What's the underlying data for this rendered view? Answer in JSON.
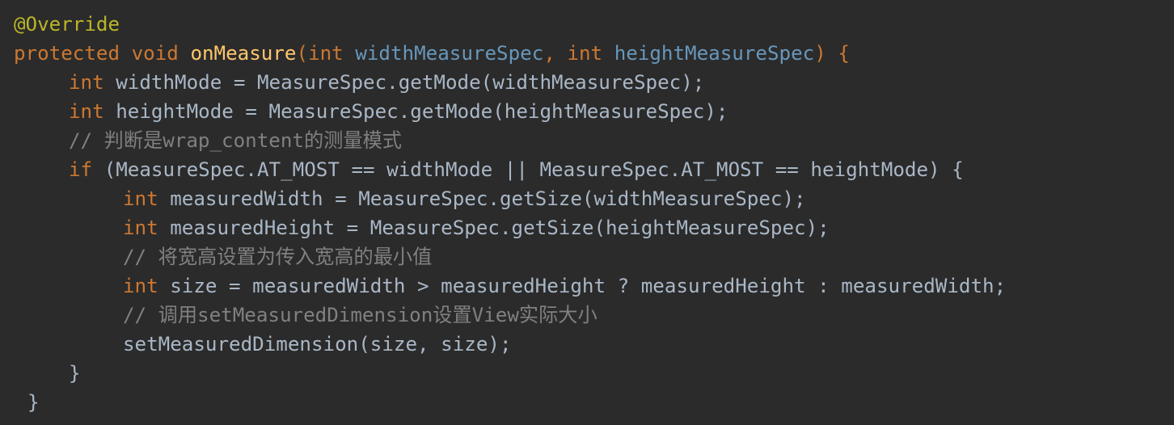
{
  "code": {
    "l1": {
      "annotation": "@Override"
    },
    "l2": {
      "kw_protected": "protected",
      "kw_void": "void",
      "method": "onMeasure",
      "paren_open": "(",
      "type1": "int",
      "param1": "widthMeasureSpec",
      "comma": ", ",
      "type2": "int",
      "param2": "heightMeasureSpec",
      "paren_close": ") {"
    },
    "l3": {
      "type": "int",
      "rest": "widthMode = MeasureSpec.getMode(widthMeasureSpec);"
    },
    "l4": {
      "type": "int",
      "rest": "heightMode = MeasureSpec.getMode(heightMeasureSpec);"
    },
    "l5": {
      "comment": "// 判断是wrap_content的测量模式"
    },
    "l6": {
      "kw": "if",
      "rest": "(MeasureSpec.AT_MOST == widthMode || MeasureSpec.AT_MOST == heightMode) {"
    },
    "l7": {
      "type": "int",
      "rest": "measuredWidth = MeasureSpec.getSize(widthMeasureSpec);"
    },
    "l8": {
      "type": "int",
      "rest": "measuredHeight = MeasureSpec.getSize(heightMeasureSpec);"
    },
    "l9": {
      "comment": "// 将宽高设置为传入宽高的最小值"
    },
    "l10": {
      "type": "int",
      "rest": "size = measuredWidth > measuredHeight ? measuredHeight : measuredWidth;"
    },
    "l11": {
      "comment": "// 调用setMeasuredDimension设置View实际大小"
    },
    "l12": {
      "text": "setMeasuredDimension(size, size);"
    },
    "l13": {
      "text": "}"
    },
    "l14": {
      "text": "}"
    }
  },
  "colors": {
    "background": "#2b2b2b",
    "keyword": "#cc7832",
    "annotation": "#bbb529",
    "method": "#ffc66d",
    "parameter": "#6897bb",
    "text": "#a9b7c6",
    "comment": "#808080"
  }
}
